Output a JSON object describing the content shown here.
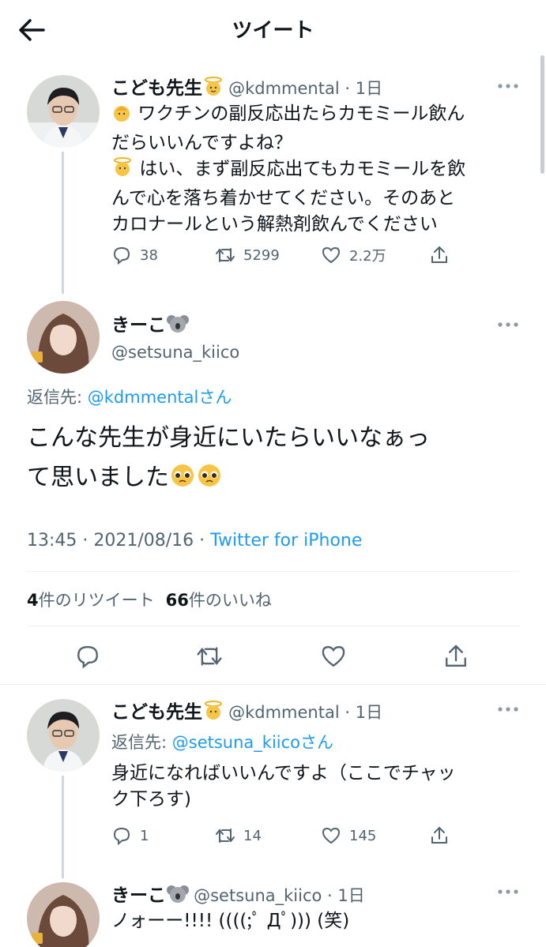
{
  "header": {
    "title": "ツイート"
  },
  "tweet1": {
    "name": "こども先生",
    "handle": "@kdmmental",
    "time": "1日",
    "line1": "ワクチンの副反応出たらカモミール飲ん",
    "line2": "だらいいんですよね？",
    "line3": "はい、まず副反応出てもカモミールを飲",
    "line4": "んで心を落ち着かせてください。そのあと",
    "line5": "カロナールという解熱剤飲んでください",
    "replies": "38",
    "retweets": "5299",
    "likes": "2.2万"
  },
  "main": {
    "name": "きーこ",
    "handle": "@setsuna_kiico",
    "reply_prefix": "返信先: ",
    "reply_to": "@kdmmentalさん",
    "line1": "こんな先生が身近にいたらいいなぁっ",
    "line2": "て思いました",
    "timestamp": "13:45 · 2021/08/16 · ",
    "source": "Twitter for iPhone",
    "retweet_count": "4",
    "retweet_label": "件のリツイート",
    "like_count": "66",
    "like_label": "件のいいね"
  },
  "reply1": {
    "name": "こども先生",
    "handle": "@kdmmental",
    "time": "1日",
    "reply_prefix": "返信先: ",
    "reply_to": "@setsuna_kiicoさん",
    "line1": "身近になればいいんですよ（ここでチャッ",
    "line2": "ク下ろす)",
    "replies": "1",
    "retweets": "14",
    "likes": "145"
  },
  "reply2": {
    "name": "きーこ",
    "handle": "@setsuna_kiico",
    "time": "1日",
    "text": "ノォーー!!!! ((((;ﾟ Дﾟ))) (笑)"
  },
  "colors": {
    "link": "#1d9bf0",
    "secondary": "#536471",
    "divider": "#eff3f4"
  }
}
